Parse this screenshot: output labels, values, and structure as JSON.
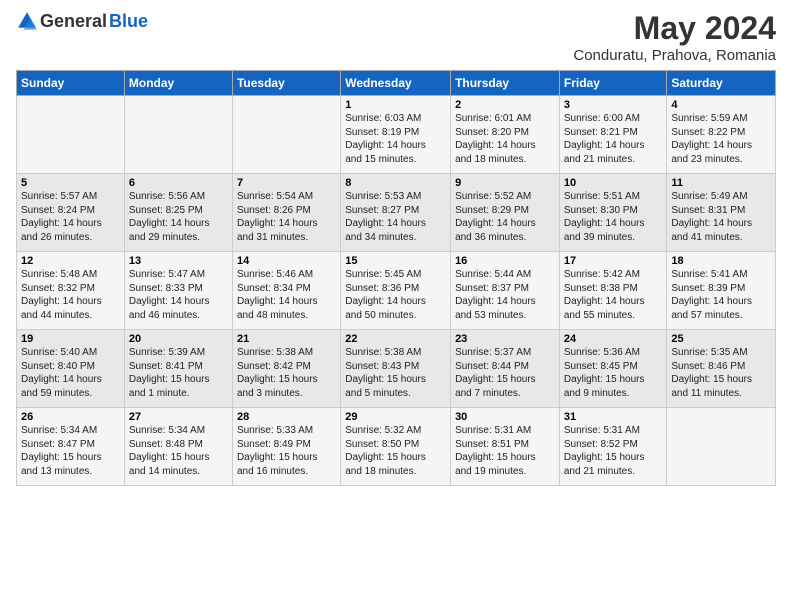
{
  "header": {
    "logo_general": "General",
    "logo_blue": "Blue",
    "title": "May 2024",
    "subtitle": "Conduratu, Prahova, Romania"
  },
  "days_of_week": [
    "Sunday",
    "Monday",
    "Tuesday",
    "Wednesday",
    "Thursday",
    "Friday",
    "Saturday"
  ],
  "weeks": [
    [
      {
        "day": "",
        "info": ""
      },
      {
        "day": "",
        "info": ""
      },
      {
        "day": "",
        "info": ""
      },
      {
        "day": "1",
        "info": "Sunrise: 6:03 AM\nSunset: 8:19 PM\nDaylight: 14 hours\nand 15 minutes."
      },
      {
        "day": "2",
        "info": "Sunrise: 6:01 AM\nSunset: 8:20 PM\nDaylight: 14 hours\nand 18 minutes."
      },
      {
        "day": "3",
        "info": "Sunrise: 6:00 AM\nSunset: 8:21 PM\nDaylight: 14 hours\nand 21 minutes."
      },
      {
        "day": "4",
        "info": "Sunrise: 5:59 AM\nSunset: 8:22 PM\nDaylight: 14 hours\nand 23 minutes."
      }
    ],
    [
      {
        "day": "5",
        "info": "Sunrise: 5:57 AM\nSunset: 8:24 PM\nDaylight: 14 hours\nand 26 minutes."
      },
      {
        "day": "6",
        "info": "Sunrise: 5:56 AM\nSunset: 8:25 PM\nDaylight: 14 hours\nand 29 minutes."
      },
      {
        "day": "7",
        "info": "Sunrise: 5:54 AM\nSunset: 8:26 PM\nDaylight: 14 hours\nand 31 minutes."
      },
      {
        "day": "8",
        "info": "Sunrise: 5:53 AM\nSunset: 8:27 PM\nDaylight: 14 hours\nand 34 minutes."
      },
      {
        "day": "9",
        "info": "Sunrise: 5:52 AM\nSunset: 8:29 PM\nDaylight: 14 hours\nand 36 minutes."
      },
      {
        "day": "10",
        "info": "Sunrise: 5:51 AM\nSunset: 8:30 PM\nDaylight: 14 hours\nand 39 minutes."
      },
      {
        "day": "11",
        "info": "Sunrise: 5:49 AM\nSunset: 8:31 PM\nDaylight: 14 hours\nand 41 minutes."
      }
    ],
    [
      {
        "day": "12",
        "info": "Sunrise: 5:48 AM\nSunset: 8:32 PM\nDaylight: 14 hours\nand 44 minutes."
      },
      {
        "day": "13",
        "info": "Sunrise: 5:47 AM\nSunset: 8:33 PM\nDaylight: 14 hours\nand 46 minutes."
      },
      {
        "day": "14",
        "info": "Sunrise: 5:46 AM\nSunset: 8:34 PM\nDaylight: 14 hours\nand 48 minutes."
      },
      {
        "day": "15",
        "info": "Sunrise: 5:45 AM\nSunset: 8:36 PM\nDaylight: 14 hours\nand 50 minutes."
      },
      {
        "day": "16",
        "info": "Sunrise: 5:44 AM\nSunset: 8:37 PM\nDaylight: 14 hours\nand 53 minutes."
      },
      {
        "day": "17",
        "info": "Sunrise: 5:42 AM\nSunset: 8:38 PM\nDaylight: 14 hours\nand 55 minutes."
      },
      {
        "day": "18",
        "info": "Sunrise: 5:41 AM\nSunset: 8:39 PM\nDaylight: 14 hours\nand 57 minutes."
      }
    ],
    [
      {
        "day": "19",
        "info": "Sunrise: 5:40 AM\nSunset: 8:40 PM\nDaylight: 14 hours\nand 59 minutes."
      },
      {
        "day": "20",
        "info": "Sunrise: 5:39 AM\nSunset: 8:41 PM\nDaylight: 15 hours\nand 1 minute."
      },
      {
        "day": "21",
        "info": "Sunrise: 5:38 AM\nSunset: 8:42 PM\nDaylight: 15 hours\nand 3 minutes."
      },
      {
        "day": "22",
        "info": "Sunrise: 5:38 AM\nSunset: 8:43 PM\nDaylight: 15 hours\nand 5 minutes."
      },
      {
        "day": "23",
        "info": "Sunrise: 5:37 AM\nSunset: 8:44 PM\nDaylight: 15 hours\nand 7 minutes."
      },
      {
        "day": "24",
        "info": "Sunrise: 5:36 AM\nSunset: 8:45 PM\nDaylight: 15 hours\nand 9 minutes."
      },
      {
        "day": "25",
        "info": "Sunrise: 5:35 AM\nSunset: 8:46 PM\nDaylight: 15 hours\nand 11 minutes."
      }
    ],
    [
      {
        "day": "26",
        "info": "Sunrise: 5:34 AM\nSunset: 8:47 PM\nDaylight: 15 hours\nand 13 minutes."
      },
      {
        "day": "27",
        "info": "Sunrise: 5:34 AM\nSunset: 8:48 PM\nDaylight: 15 hours\nand 14 minutes."
      },
      {
        "day": "28",
        "info": "Sunrise: 5:33 AM\nSunset: 8:49 PM\nDaylight: 15 hours\nand 16 minutes."
      },
      {
        "day": "29",
        "info": "Sunrise: 5:32 AM\nSunset: 8:50 PM\nDaylight: 15 hours\nand 18 minutes."
      },
      {
        "day": "30",
        "info": "Sunrise: 5:31 AM\nSunset: 8:51 PM\nDaylight: 15 hours\nand 19 minutes."
      },
      {
        "day": "31",
        "info": "Sunrise: 5:31 AM\nSunset: 8:52 PM\nDaylight: 15 hours\nand 21 minutes."
      },
      {
        "day": "",
        "info": ""
      }
    ]
  ]
}
